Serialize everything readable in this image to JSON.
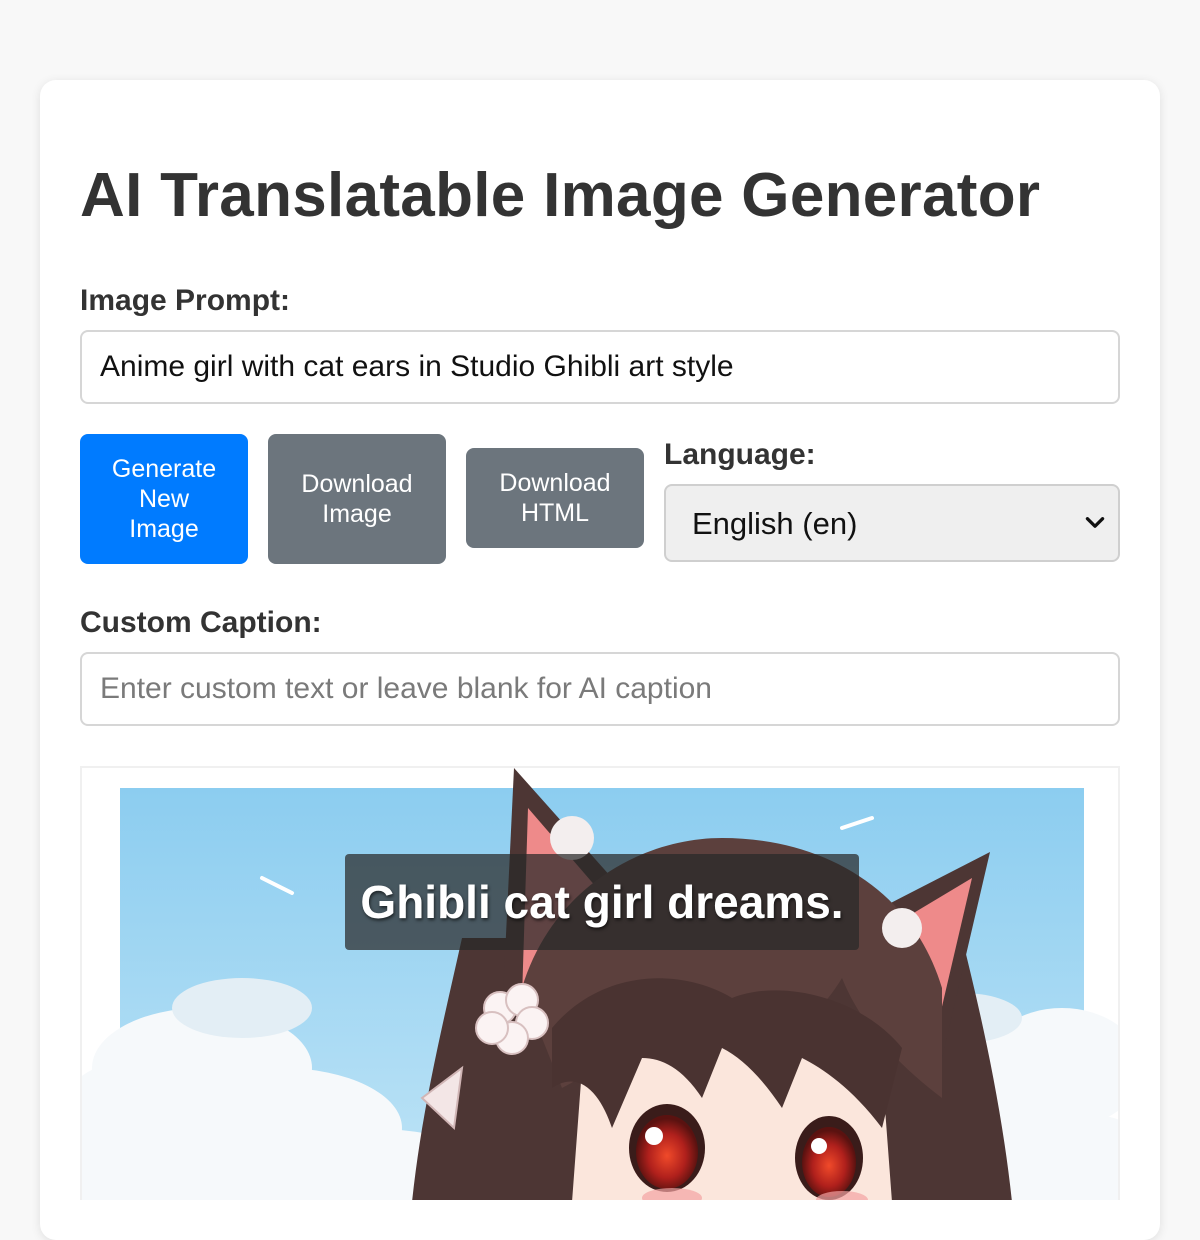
{
  "app": {
    "title": "AI Translatable Image Generator"
  },
  "prompt": {
    "label": "Image Prompt:",
    "value": "Anime girl with cat ears in Studio Ghibli art style"
  },
  "buttons": {
    "generate_line1": "Generate",
    "generate_line2": "New",
    "generate_line3": "Image",
    "download_image_line1": "Download",
    "download_image_line2": "Image",
    "download_html_line1": "Download",
    "download_html_line2": "HTML"
  },
  "language": {
    "label": "Language:",
    "selected": "English (en)"
  },
  "caption": {
    "label": "Custom Caption:",
    "value": "",
    "placeholder": "Enter custom text or leave blank for AI caption"
  },
  "image": {
    "overlay_text": "Ghibli cat girl dreams.",
    "subject_icon": "anime-cat-girl-illustration"
  },
  "colors": {
    "primary": "#007bff",
    "secondary": "#6c757d",
    "sky": "#8fd0f0"
  }
}
